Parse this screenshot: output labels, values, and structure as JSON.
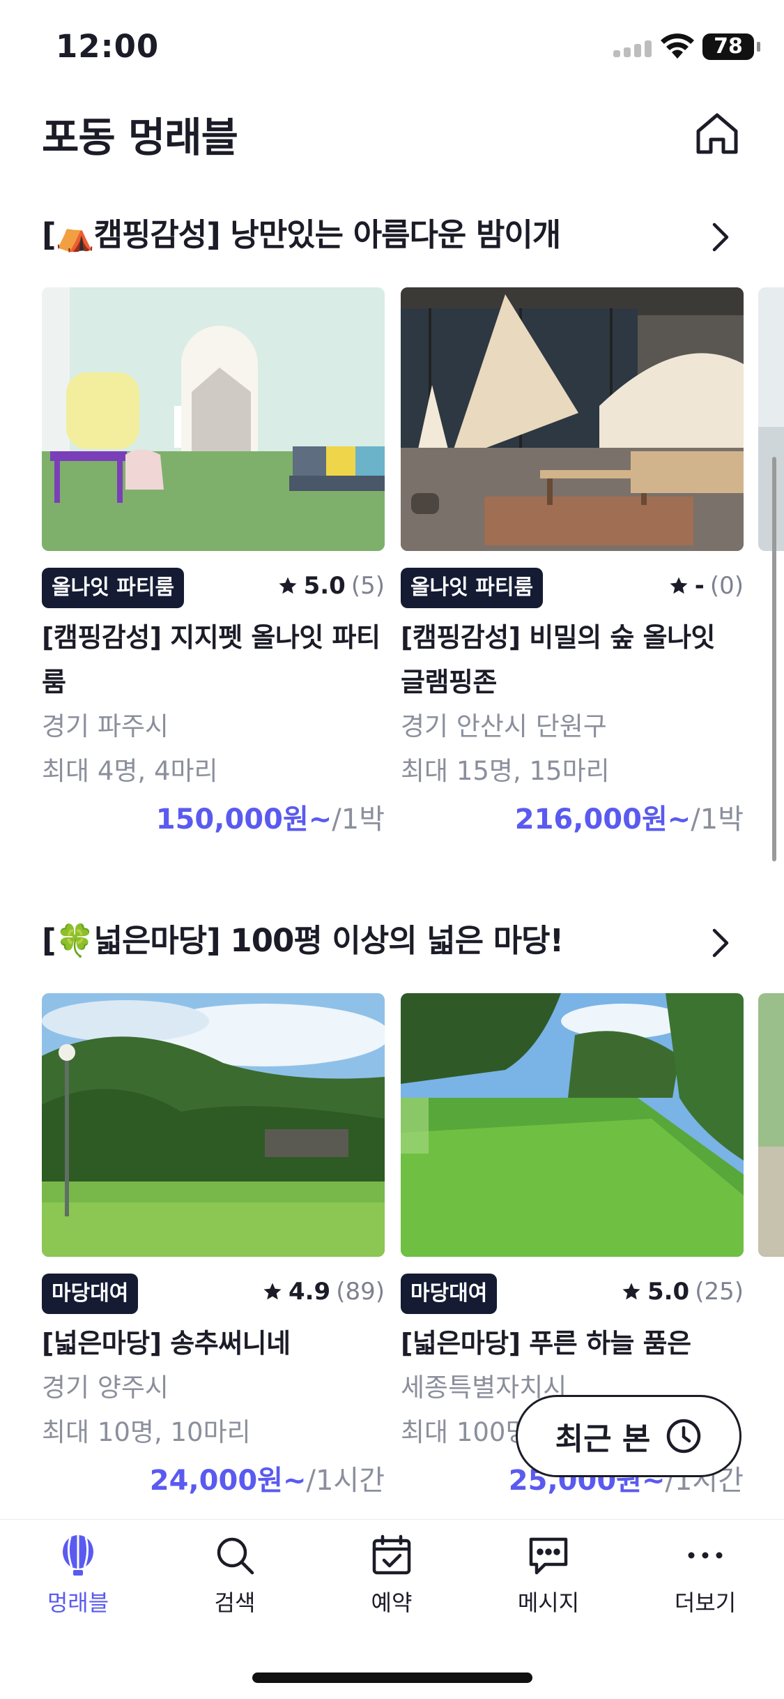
{
  "status": {
    "time": "12:00",
    "battery": "78"
  },
  "header": {
    "title": "포동 멍래블"
  },
  "sections": [
    {
      "title": "[⛺캠핑감성] 낭만있는 아름다운 밤이개",
      "cards": [
        {
          "tag": "올나잇 파티룸",
          "rating": "5.0",
          "count": "(5)",
          "name": "[캠핑감성] 지지펫 올나잇 파티룸",
          "location": "경기 파주시",
          "capacity": "최대 4명, 4마리",
          "price": "150,000원~",
          "unit": "/1박"
        },
        {
          "tag": "올나잇 파티룸",
          "rating": "-",
          "count": "(0)",
          "name": "[캠핑감성] 비밀의 숲 올나잇 글램핑존",
          "location": "경기 안산시 단원구",
          "capacity": "최대 15명, 15마리",
          "price": "216,000원~",
          "unit": "/1박"
        }
      ]
    },
    {
      "title": "[🍀넓은마당] 100평 이상의 넓은 마당!",
      "cards": [
        {
          "tag": "마당대여",
          "rating": "4.9",
          "count": "(89)",
          "name": "[넓은마당] 송추써니네",
          "location": "경기 양주시",
          "capacity": "최대 10명, 10마리",
          "price": "24,000원~",
          "unit": "/1시간"
        },
        {
          "tag": "마당대여",
          "rating": "5.0",
          "count": "(25)",
          "name": "[넓은마당] 푸른 하늘 품은",
          "location": "세종특별자치시",
          "capacity": "최대 100명",
          "price": "25,000원~",
          "unit": "/1시간"
        }
      ]
    }
  ],
  "recent": {
    "label": "최근 본"
  },
  "tabs": [
    {
      "label": "멍래블",
      "icon": "balloon-icon"
    },
    {
      "label": "검색",
      "icon": "search-icon"
    },
    {
      "label": "예약",
      "icon": "calendar-check-icon"
    },
    {
      "label": "메시지",
      "icon": "message-icon"
    },
    {
      "label": "더보기",
      "icon": "more-icon"
    }
  ],
  "colors": {
    "accent": "#5a5af0",
    "tag_bg": "#141b33",
    "muted": "#8b8f9c"
  }
}
